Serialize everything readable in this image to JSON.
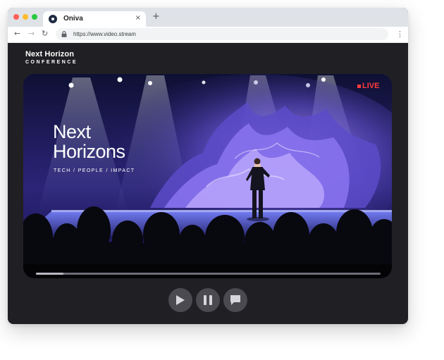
{
  "browser": {
    "tab_title": "Oniva",
    "tab_close": "×",
    "new_tab": "+",
    "url": "https://www.video.stream",
    "nav": {
      "back": "←",
      "forward": "→",
      "reload": "↻",
      "menu": "⋮"
    }
  },
  "page": {
    "brand_title": "Next Horizon",
    "brand_subtitle": "CONFERENCE"
  },
  "video": {
    "live_label": "LIVE",
    "stage_title_line1": "Next",
    "stage_title_line2": "Horizons",
    "stage_tagline": "TECH / PEOPLE / IMPACT",
    "progress_fraction": 0.08
  },
  "controls": [
    {
      "name": "play-button",
      "icon": "play-icon"
    },
    {
      "name": "pause-button",
      "icon": "pause-icon"
    },
    {
      "name": "chat-button",
      "icon": "chat-icon"
    }
  ],
  "colors": {
    "accent_live": "#ff3b3b",
    "window_bg": "#202024",
    "control_bg": "#4a4a50",
    "stage_purple": "#8a6de0"
  }
}
